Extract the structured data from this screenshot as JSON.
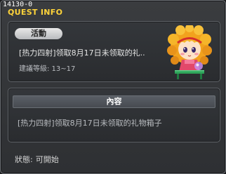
{
  "window": {
    "quest_code": "14130-0",
    "title": "QUEST INFO"
  },
  "summary": {
    "category_tag": "活動",
    "quest_name": "[热力四射]领取8月17日未领取的礼..",
    "recommended_level": "建議等級: 13~17",
    "npc_portrait_icon": "npc-girl-portrait-icon"
  },
  "content": {
    "header": "內容",
    "text": "[热力四射]领取8月17日未领取的礼物箱子"
  },
  "status": {
    "label": "狀態:",
    "value": "可開始"
  },
  "colors": {
    "title": "#ffd43a",
    "background": "#2e3033",
    "border": "#6b6f74"
  }
}
